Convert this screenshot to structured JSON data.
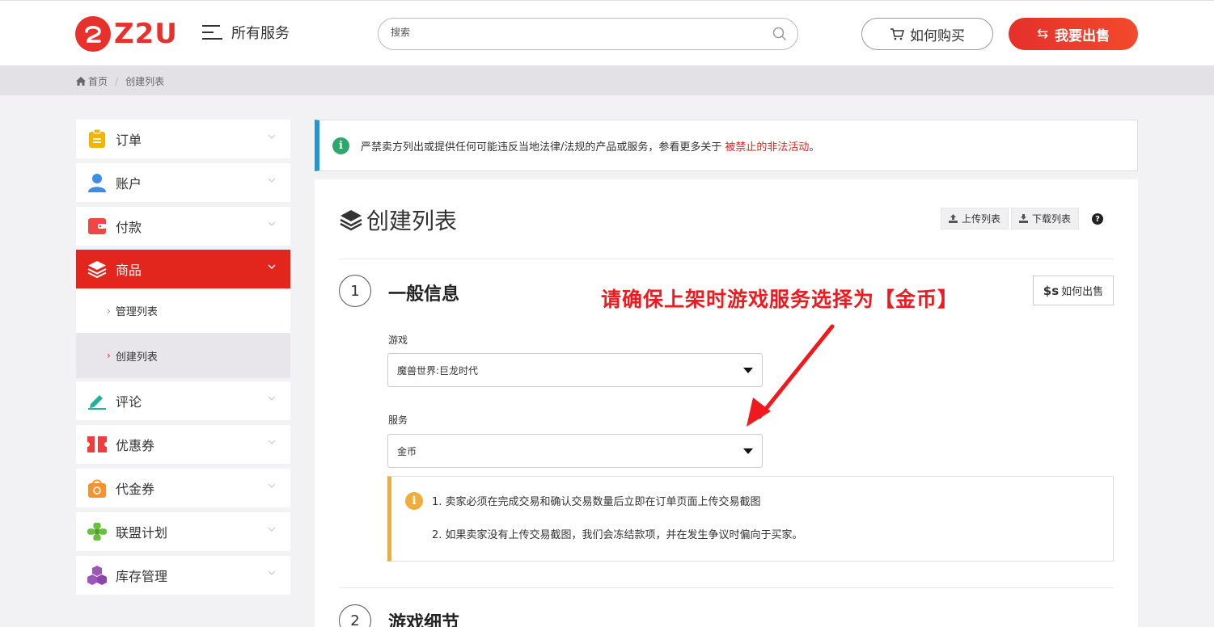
{
  "header": {
    "logo_text": "Z2U",
    "all_services": "所有服务",
    "search_placeholder": "搜索",
    "how_to_buy": "如何购买",
    "sell": "我要出售"
  },
  "breadcrumb": {
    "home": "首页",
    "current": "创建列表"
  },
  "sidebar": {
    "items": [
      {
        "label": "订单",
        "icon": "clipboard-icon"
      },
      {
        "label": "账户",
        "icon": "user-icon"
      },
      {
        "label": "付款",
        "icon": "wallet-icon"
      },
      {
        "label": "商品",
        "icon": "layers-icon"
      },
      {
        "label": "评论",
        "icon": "pen-icon"
      },
      {
        "label": "优惠券",
        "icon": "ticket-icon"
      },
      {
        "label": "代金券",
        "icon": "bag-icon"
      },
      {
        "label": "联盟计划",
        "icon": "network-icon"
      },
      {
        "label": "库存管理",
        "icon": "cubes-icon"
      }
    ],
    "sub_items": [
      {
        "label": "管理列表"
      },
      {
        "label": "创建列表"
      }
    ]
  },
  "notice": {
    "text": "严禁卖方列出或提供任何可能违反当地法律/法规的产品或服务，参看更多关于",
    "link": "被禁止的非法活动",
    "end": "。"
  },
  "main": {
    "title": "创建列表",
    "upload": "上传列表",
    "download": "下载列表",
    "help": "?",
    "step1_num": "1",
    "step1_title": "一般信息",
    "how_sell_symbol": "$s",
    "how_sell": "如何出售",
    "annotation": "请确保上架时游戏服务选择为【金币】",
    "game_label": "游戏",
    "game_value": "魔兽世界:巨龙时代",
    "service_label": "服务",
    "service_value": "金币",
    "warn_icon": "i",
    "warn_line1": "1. 卖家必须在完成交易和确认交易数量后立即在订单页面上传交易截图",
    "warn_line2": "2. 如果卖家没有上传交易截图，我们会冻结款项，并在发生争议时偏向于买家。",
    "step2_num": "2",
    "step2_title": "游戏细节"
  },
  "colors": {
    "brand_red": "#e2261e",
    "notice_blue": "#2196d6",
    "warn_orange": "#f0ad3e",
    "annotation_red": "#f0191d"
  }
}
